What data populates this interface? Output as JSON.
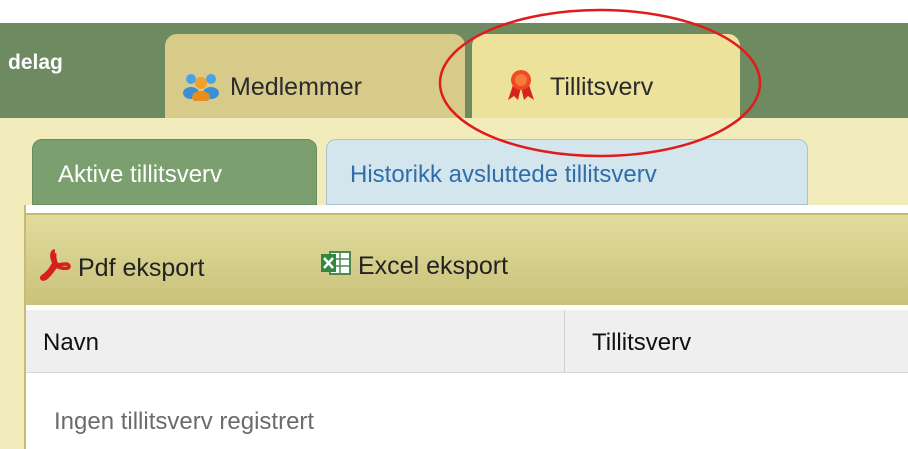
{
  "header": {
    "org_label": "delag",
    "tabs": [
      {
        "label": "Medlemmer",
        "icon": "people-icon"
      },
      {
        "label": "Tillitsverv",
        "icon": "ribbon-award-icon"
      }
    ]
  },
  "subtabs": [
    {
      "label": "Aktive tillitsverv",
      "active": true
    },
    {
      "label": "Historikk avsluttede tillitsverv",
      "active": false
    }
  ],
  "toolbar": {
    "pdf_label": "Pdf eksport",
    "excel_label": "Excel eksport"
  },
  "table": {
    "columns": [
      "Navn",
      "Tillitsverv"
    ],
    "empty_message": "Ingen tillitsverv registrert"
  },
  "colors": {
    "topbar": "#6e8a61",
    "active_subtab": "#7b9f6f",
    "link_blue": "#2f6eab",
    "highlight_circle": "#e11b1b"
  }
}
